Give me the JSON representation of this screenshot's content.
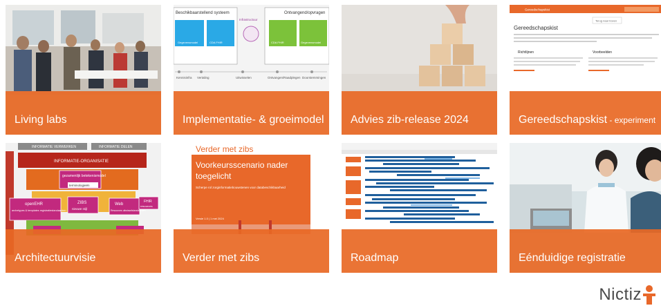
{
  "tiles": [
    {
      "label": "Living labs"
    },
    {
      "label": "Implementatie- & groeimodel"
    },
    {
      "label": "Advies zib-release 2024"
    },
    {
      "label": "Gereedschapskist",
      "suffix": " - experiment"
    },
    {
      "label": "Architectuurvisie"
    },
    {
      "label": "Verder met zibs"
    },
    {
      "label": "Roadmap"
    },
    {
      "label": "Eénduidige registratie"
    }
  ],
  "thumbnails": {
    "implementatie": {
      "left_title": "Beschikbaarstellend systeem",
      "right_title": "Ontvangend/opvragen",
      "center": "Infrastructuur",
      "box1": "Gegevensmodel",
      "box2": "CDA FHIR",
      "box3": "CDA FHIR",
      "box4": "Gegevensmodel",
      "foot1": "Kennisinfra",
      "foot2": "Vertaling",
      "foot3": "Uitwisselen",
      "foot4": "Ontvangen/Raadplegen",
      "foot5": "Doorstemmingen"
    },
    "gereedschapskist": {
      "topbar": "Gereedschapskist",
      "title": "Gereedschapskist",
      "button": "Terug naar boven",
      "col1": "Richtlijnen",
      "col2": "Voorbeelden"
    },
    "architectuur": {
      "top_left": "INFORMATIE VERWERKEN",
      "top_right": "INFORMATIE DELEN",
      "org": "INFORMATIE-ORGANISATIE",
      "side": "ZORGDOMEIN",
      "semantic": "gezamenlijk betekenismodel",
      "term": "terminologieën",
      "zibs": "ZIBS",
      "zibs_sub": "nieuwe stijl",
      "openehr": "openEHR",
      "openehr_sub": "archetypes & templates registratiestandaarden",
      "web": "Web",
      "web_sub": "Resources uitwisselstandaarden",
      "fhir": "FHIR",
      "fhir_sub": "resources"
    },
    "verder": {
      "heading": "Verder met zibs",
      "title": "Voorkeursscenario nader toegelicht",
      "subtitle": "Scherpe rol zorginformatiebouwstenen voor databeschikbaarheid",
      "version": "Versie 1.0 | 1 mei 2024"
    }
  },
  "logo": {
    "text": "Nictiz"
  }
}
